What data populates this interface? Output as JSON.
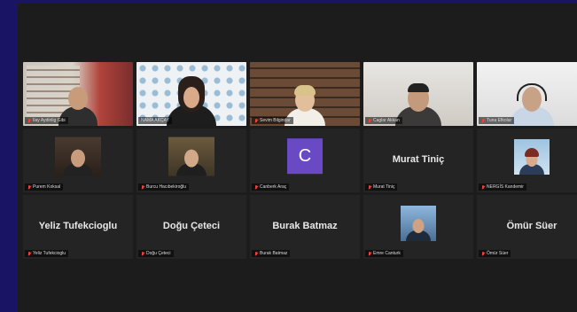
{
  "colors": {
    "page_bg": "#1a1464",
    "meeting_bg": "#1c1c1c",
    "tile_bg": "#242424",
    "speaker_outline": "#b8e23c",
    "muted_icon": "#ff3b30",
    "avatar_bg": "#6a4ac4"
  },
  "participants": [
    {
      "label": "Ilay Aydinlig Gibi",
      "kind": "video",
      "muted": true
    },
    {
      "label": "NAMA AKÇAY",
      "kind": "video",
      "muted": false,
      "active_speaker": true
    },
    {
      "label": "Sevim Bilgindar",
      "kind": "video",
      "muted": true
    },
    {
      "label": "Caglar Akkan",
      "kind": "video",
      "muted": true
    },
    {
      "label": "Tuna Efkolar",
      "kind": "video",
      "muted": true
    },
    {
      "label": "Purem Koksal",
      "kind": "video",
      "muted": true
    },
    {
      "label": "Burcu Hacıbekiroğlu",
      "kind": "video",
      "muted": true
    },
    {
      "label": "Canberk Araç",
      "kind": "avatar",
      "avatar_letter": "C",
      "muted": true
    },
    {
      "label": "Murat Tiniç",
      "kind": "name",
      "display_name": "Murat Tiniç",
      "muted": true
    },
    {
      "label": "NERGİS Kandemir",
      "kind": "photo",
      "muted": true
    },
    {
      "label": "Yeliz Tufekcioglu",
      "kind": "name",
      "display_name": "Yeliz Tufekcioglu",
      "muted": true
    },
    {
      "label": "Doğu Çeteci",
      "kind": "name",
      "display_name": "Doğu Çeteci",
      "muted": true
    },
    {
      "label": "Burak Batmaz",
      "kind": "name",
      "display_name": "Burak Batmaz",
      "muted": true
    },
    {
      "label": "Emre Canturk",
      "kind": "photo",
      "muted": true
    },
    {
      "label": "Ömür Süer",
      "kind": "name",
      "display_name": "Ömür Süer",
      "muted": true
    }
  ]
}
